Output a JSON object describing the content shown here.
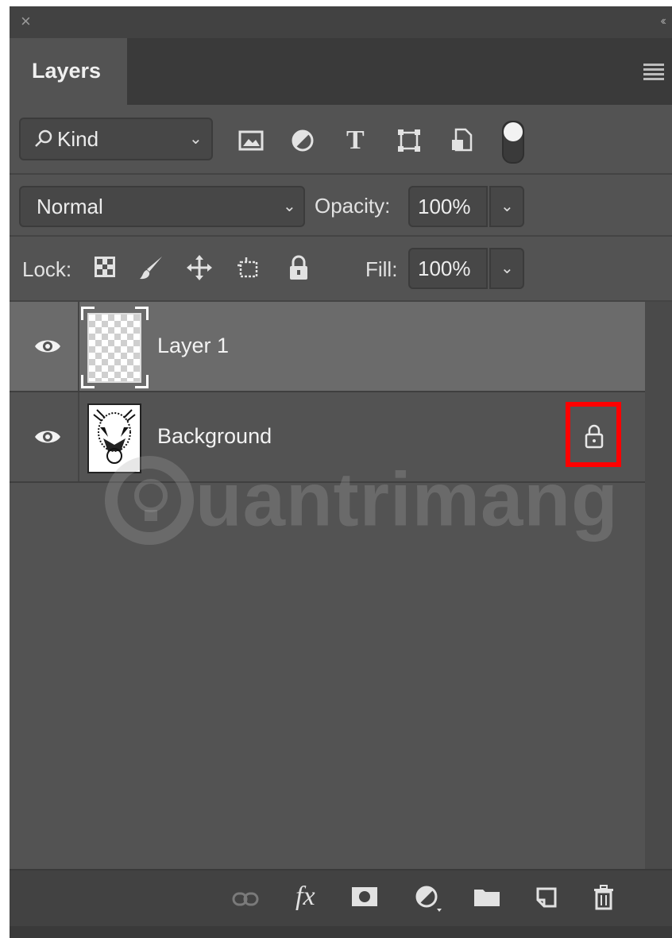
{
  "panel": {
    "close_glyph": "×",
    "collapse_glyph": "‹‹"
  },
  "tabs": {
    "active_label": "Layers"
  },
  "filter": {
    "kind_label": "Kind",
    "filter_icons": [
      "image-filter-icon",
      "adjustment-filter-icon",
      "type-filter-icon",
      "shape-filter-icon",
      "smart-object-filter-icon"
    ]
  },
  "blend": {
    "mode": "Normal",
    "opacity_label": "Opacity:",
    "opacity_value": "100%"
  },
  "lock": {
    "label": "Lock:",
    "fill_label": "Fill:",
    "fill_value": "100%"
  },
  "layers": [
    {
      "name": "Layer 1",
      "selected": true,
      "visible": true,
      "locked": false
    },
    {
      "name": "Background",
      "selected": false,
      "visible": true,
      "locked": true
    }
  ],
  "watermark": "uantrimang",
  "footer": {
    "fx_label": "fx",
    "icons": [
      "link-layers-icon",
      "fx-icon",
      "add-mask-icon",
      "new-adjustment-icon",
      "new-group-icon",
      "new-layer-icon",
      "delete-layer-icon"
    ]
  },
  "colors": {
    "panel_bg": "#535353",
    "selected_row": "#6b6b6b",
    "highlight": "#ff0000"
  }
}
